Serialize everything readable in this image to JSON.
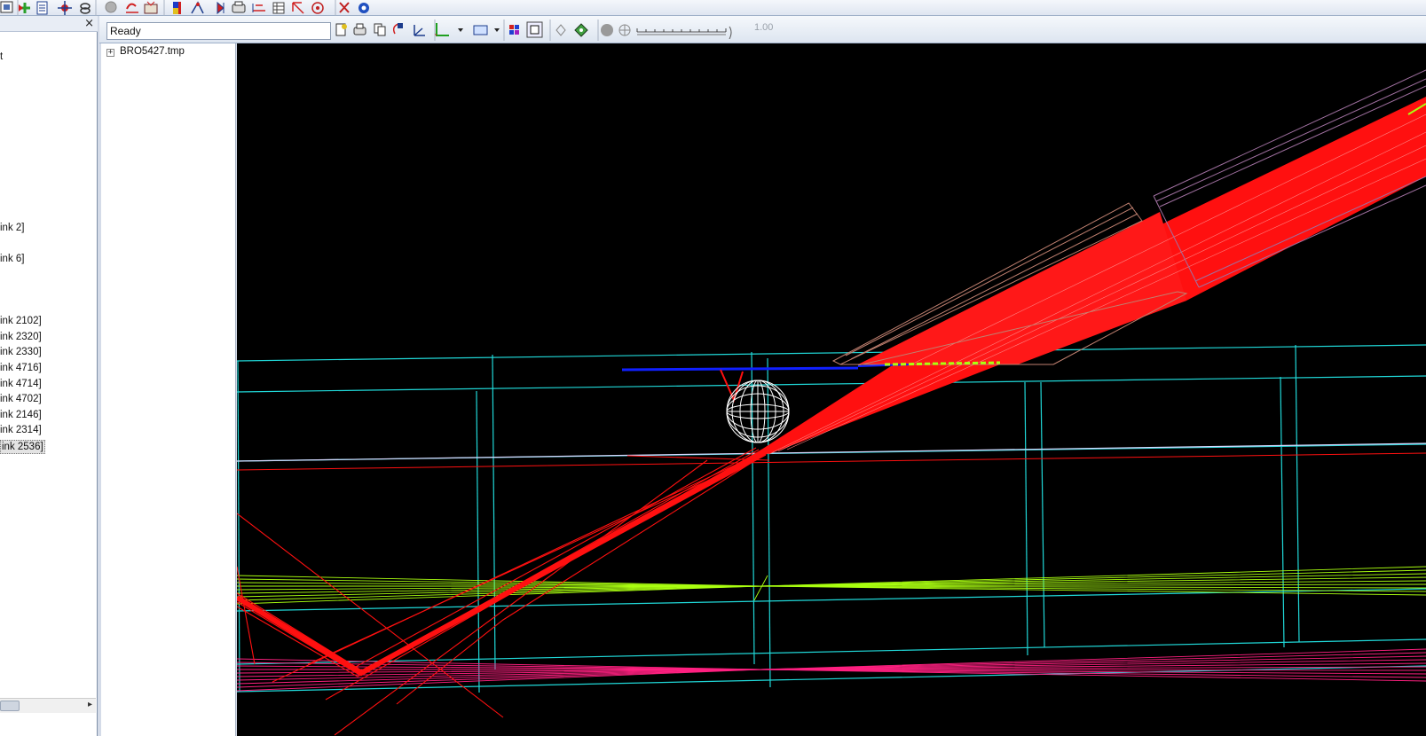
{
  "toolbar": {
    "icons": [
      "open-icon",
      "add-icon",
      "document-icon",
      "move-icon",
      "link-icon",
      "stop-icon",
      "undo-icon",
      "ray-icon",
      "color-icon",
      "trace-icon",
      "rewind-icon",
      "print-icon",
      "dimension-icon",
      "table-icon",
      "select-icon",
      "target-icon",
      "delete-icon",
      "settings-icon"
    ]
  },
  "left_panel": {
    "close_label": "×",
    "items": [
      {
        "label": "t",
        "selected": false
      },
      {
        "label": "ink 2]",
        "selected": false
      },
      {
        "label": "ink 6]",
        "selected": false
      },
      {
        "label": "ink 2102]",
        "selected": false
      },
      {
        "label": "ink 2320]",
        "selected": false
      },
      {
        "label": "ink 2330]",
        "selected": false
      },
      {
        "label": "ink 4716]",
        "selected": false
      },
      {
        "label": "ink 4714]",
        "selected": false
      },
      {
        "label": "ink 4702]",
        "selected": false
      },
      {
        "label": "ink 2146]",
        "selected": false
      },
      {
        "label": "ink 2314]",
        "selected": false
      },
      {
        "label": "ink 2536]",
        "selected": true
      }
    ]
  },
  "secondary_toolbar": {
    "status": "Ready",
    "zoom_value": "1.00"
  },
  "tree": {
    "expander": "+",
    "root_label": "BRO5427.tmp"
  },
  "viewport": {
    "background": "#000000",
    "colors": {
      "rays": "#ff1010",
      "enclosure": "#20d8d8",
      "green_rays": "#aaff10",
      "pink_rays": "#ff2080",
      "blue_plate": "#1020ff",
      "pipe_outer": "#c08070",
      "pipe_inner": "#a070a0",
      "sphere": "#ffffff"
    }
  }
}
